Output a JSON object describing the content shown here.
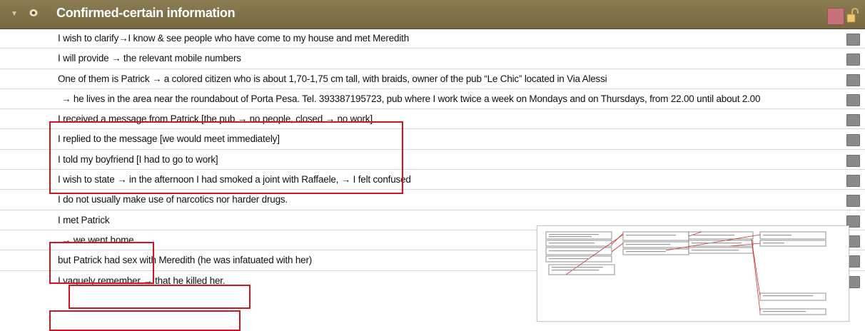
{
  "header": {
    "title": "Confirmed-certain information",
    "toggle_icon": "triangle-down-icon",
    "visibility_icon": "eye-icon",
    "flag_color": "#c7727a",
    "lock_icon": "unlock-icon"
  },
  "rows": [
    {
      "text": "I wish to clarify→I know & see people who have come to my house and met Meredith"
    },
    {
      "text": "I will provide → the relevant mobile numbers"
    },
    {
      "text": "One of them is Patrick → a colored citizen who is about 1,70-1,75 cm tall,  with braids, owner of the pub  “Le Chic”  located in Via Alessi"
    },
    {
      "text": "→ he lives in the area near the roundabout of Porta Pesa. Tel. 393387195723,  pub where I work twice a week on Mondays and on Thursdays,  from 22.00 until about 2.00"
    },
    {
      "text": "I received a message from Patrick [the pub → no people, closed → no work]"
    },
    {
      "text": "I replied to the message [we would meet immediately]"
    },
    {
      "text": "I told my boyfriend [I had to go to work]"
    },
    {
      "text": "I wish to state → in the afternoon I had smoked a joint with Raffaele,  → I felt confused"
    },
    {
      "text": "I do not usually make use of narcotics nor harder drugs."
    },
    {
      "text": "I met Patrick"
    },
    {
      "text": "→ we went home."
    },
    {
      "text": "but Patrick had sex with Meredith (he was infatuated with her)"
    },
    {
      "text": "I vaguely remember → that he killed her."
    }
  ],
  "highlight_color": "#d41420",
  "row_marker_color": "#8a8a8a"
}
